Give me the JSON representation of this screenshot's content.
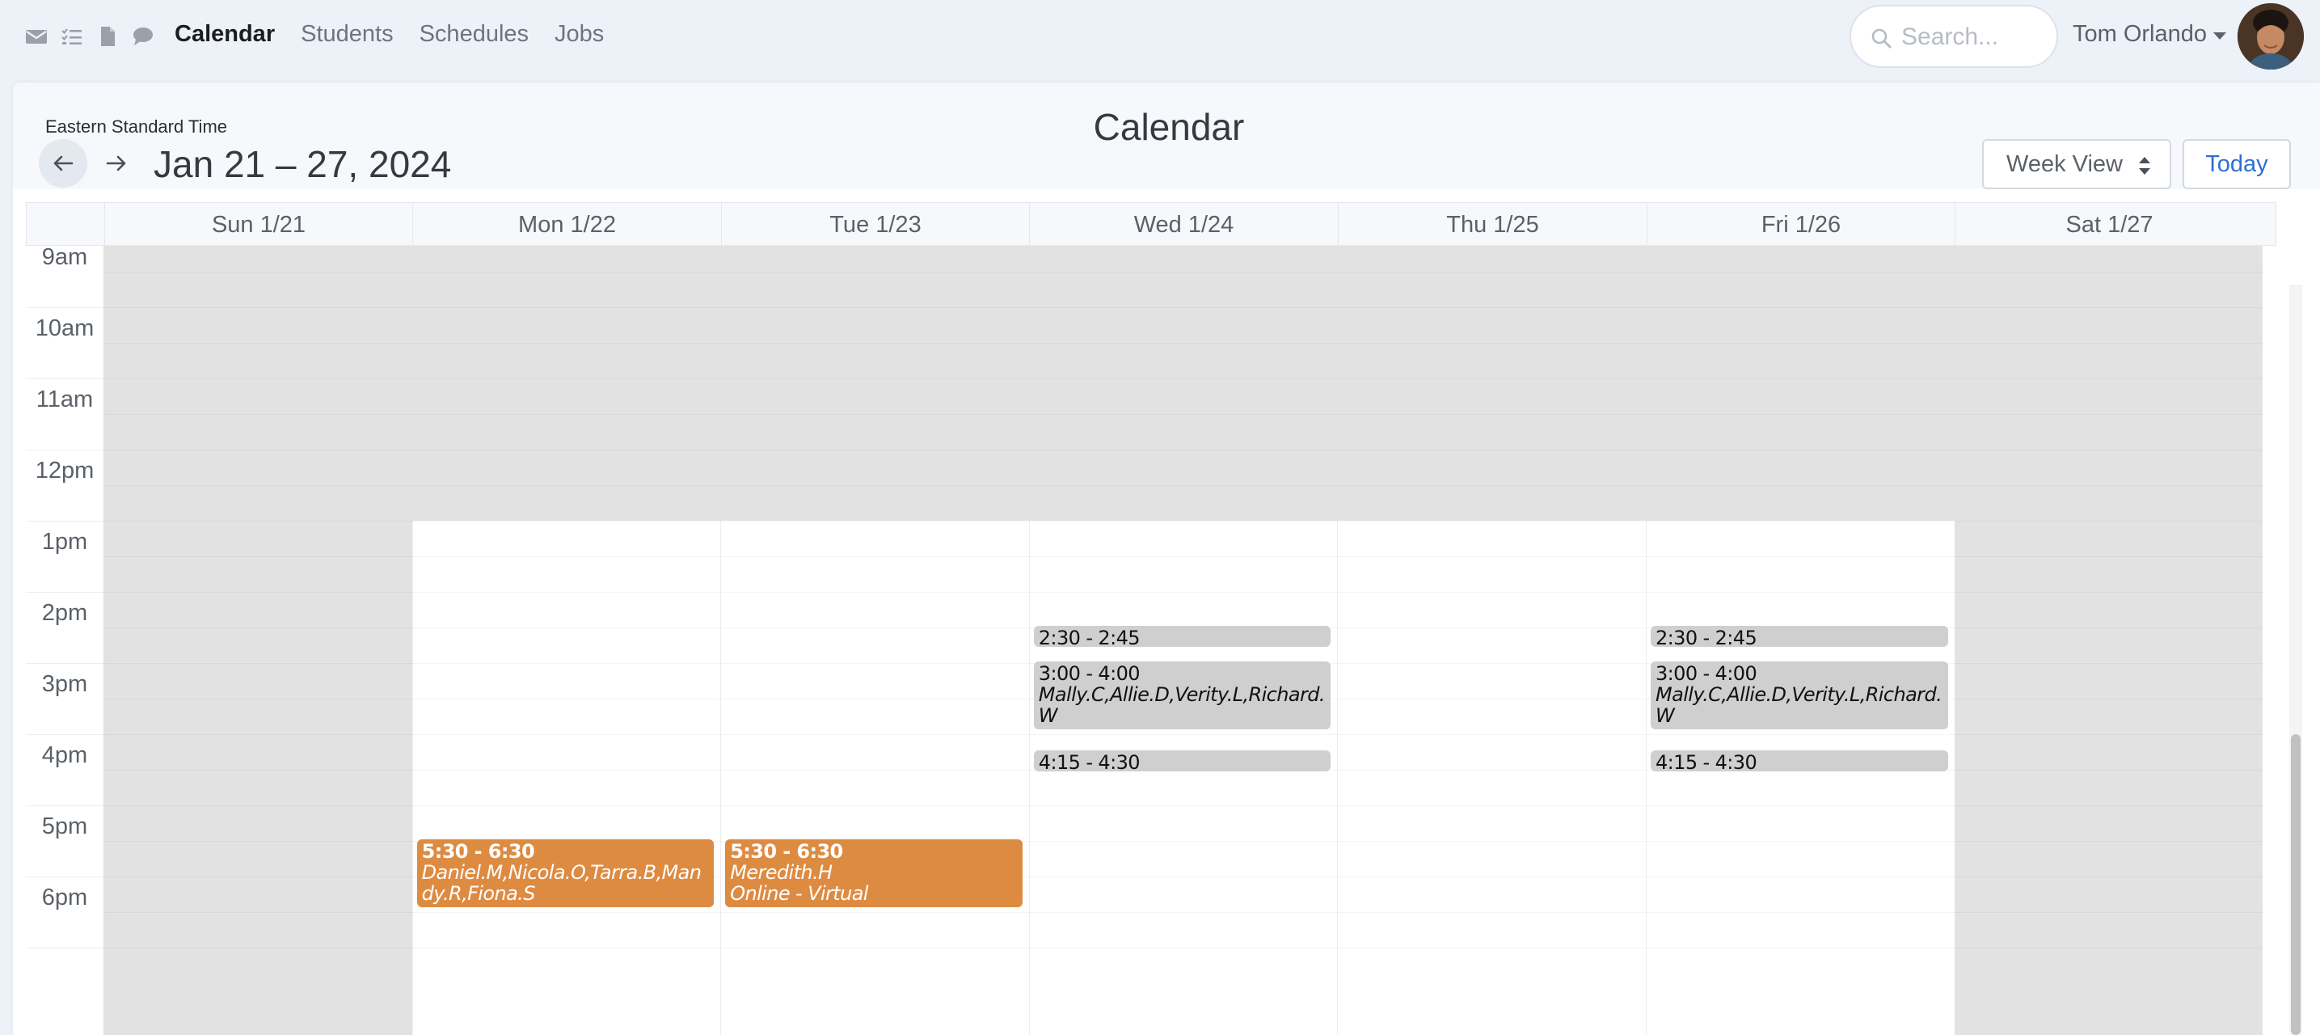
{
  "nav": {
    "icons": [
      "envelope-icon",
      "checklist-icon",
      "document-icon",
      "chat-icon"
    ],
    "links": [
      {
        "label": "Calendar",
        "active": true
      },
      {
        "label": "Students",
        "active": false
      },
      {
        "label": "Schedules",
        "active": false
      },
      {
        "label": "Jobs",
        "active": false
      }
    ],
    "search_placeholder": "Search...",
    "user_name": "Tom Orlando"
  },
  "calendar": {
    "timezone": "Eastern Standard Time",
    "title": "Calendar",
    "range_label": "Jan 21 – 27, 2024",
    "view_label": "Week View",
    "today_label": "Today",
    "days": [
      "Sun 1/21",
      "Mon 1/22",
      "Tue 1/23",
      "Wed 1/24",
      "Thu 1/25",
      "Fri 1/26",
      "Sat 1/27"
    ],
    "hours": [
      "9am",
      "10am",
      "11am",
      "12pm",
      "1pm",
      "2pm",
      "3pm",
      "4pm",
      "5pm",
      "6pm"
    ],
    "events": [
      {
        "day": 3,
        "time": "2:30 - 2:45",
        "lines": [],
        "color": "grey"
      },
      {
        "day": 3,
        "time": "3:00 - 4:00",
        "lines": [
          "Mally.C,Allie.D,Verity.L,Richard.W"
        ],
        "color": "grey"
      },
      {
        "day": 3,
        "time": "4:15 - 4:30",
        "lines": [],
        "color": "grey"
      },
      {
        "day": 5,
        "time": "2:30 - 2:45",
        "lines": [],
        "color": "grey"
      },
      {
        "day": 5,
        "time": "3:00 - 4:00",
        "lines": [
          "Mally.C,Allie.D,Verity.L,Richard.W"
        ],
        "color": "grey"
      },
      {
        "day": 5,
        "time": "4:15 - 4:30",
        "lines": [],
        "color": "grey"
      },
      {
        "day": 1,
        "time": "5:30 - 6:30",
        "lines": [
          "Daniel.M,Nicola.O,Tarra.B,Mandy.R,Fiona.S"
        ],
        "color": "orange"
      },
      {
        "day": 2,
        "time": "5:30 - 6:30",
        "lines": [
          "Meredith.H",
          "Online - Virtual"
        ],
        "color": "orange"
      }
    ],
    "colors": {
      "grey": "#cfcfcf",
      "orange": "#de8b42",
      "unavailable": "#e2e2e2"
    }
  }
}
